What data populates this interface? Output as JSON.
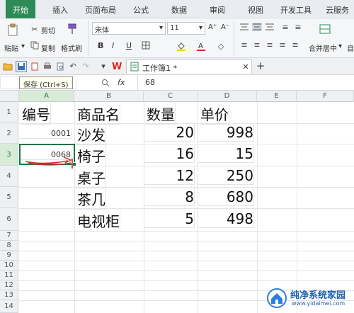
{
  "ribbon_tabs": [
    "开始",
    "插入",
    "页面布局",
    "公式",
    "数据",
    "审阅",
    "视图",
    "开发工具",
    "云服务"
  ],
  "ribbon": {
    "paste": "粘贴",
    "paste_arrow": "▾",
    "cut": "剪切",
    "copy": "复制",
    "format_painter": "格式刷",
    "font_name": "宋体",
    "font_size": "11",
    "bold": "B",
    "italic": "I",
    "underline": "U",
    "grow_font": "A⁺",
    "shrink_font": "A⁻",
    "merge_center": "合并居中",
    "merge_arrow": "▾",
    "wrap": "自"
  },
  "quick_access": {
    "document_tab": "工作簿1 *",
    "save_tooltip": "保存 (Ctrl+S)"
  },
  "formula_bar": {
    "fx": "fx",
    "value": "68"
  },
  "columns": [
    "A",
    "B",
    "C",
    "D",
    "E",
    "F"
  ],
  "rows": [
    "1",
    "2",
    "3",
    "4",
    "5",
    "6",
    "7",
    "8",
    "9",
    "10",
    "11",
    "12",
    "13",
    "14"
  ],
  "cells": {
    "A1": "编号",
    "B1": "商品名",
    "C1": "数量",
    "D1": "单价",
    "A2": "0001",
    "B2": "沙发",
    "C2": "20",
    "D2": "998",
    "A3": "0068",
    "B3": "椅子",
    "C3": "16",
    "D3": "15",
    "B4": "桌子",
    "C4": "12",
    "D4": "250",
    "B5": "茶几",
    "C5": "8",
    "D5": "680",
    "B6": "电视柜",
    "C6": "5",
    "D6": "498"
  },
  "watermark": {
    "brand": "纯净系统家园",
    "url": "www.yidaimei.com"
  },
  "colors": {
    "accent": "#2e8b57",
    "selection": "#217346",
    "annotation": "#d62828"
  }
}
